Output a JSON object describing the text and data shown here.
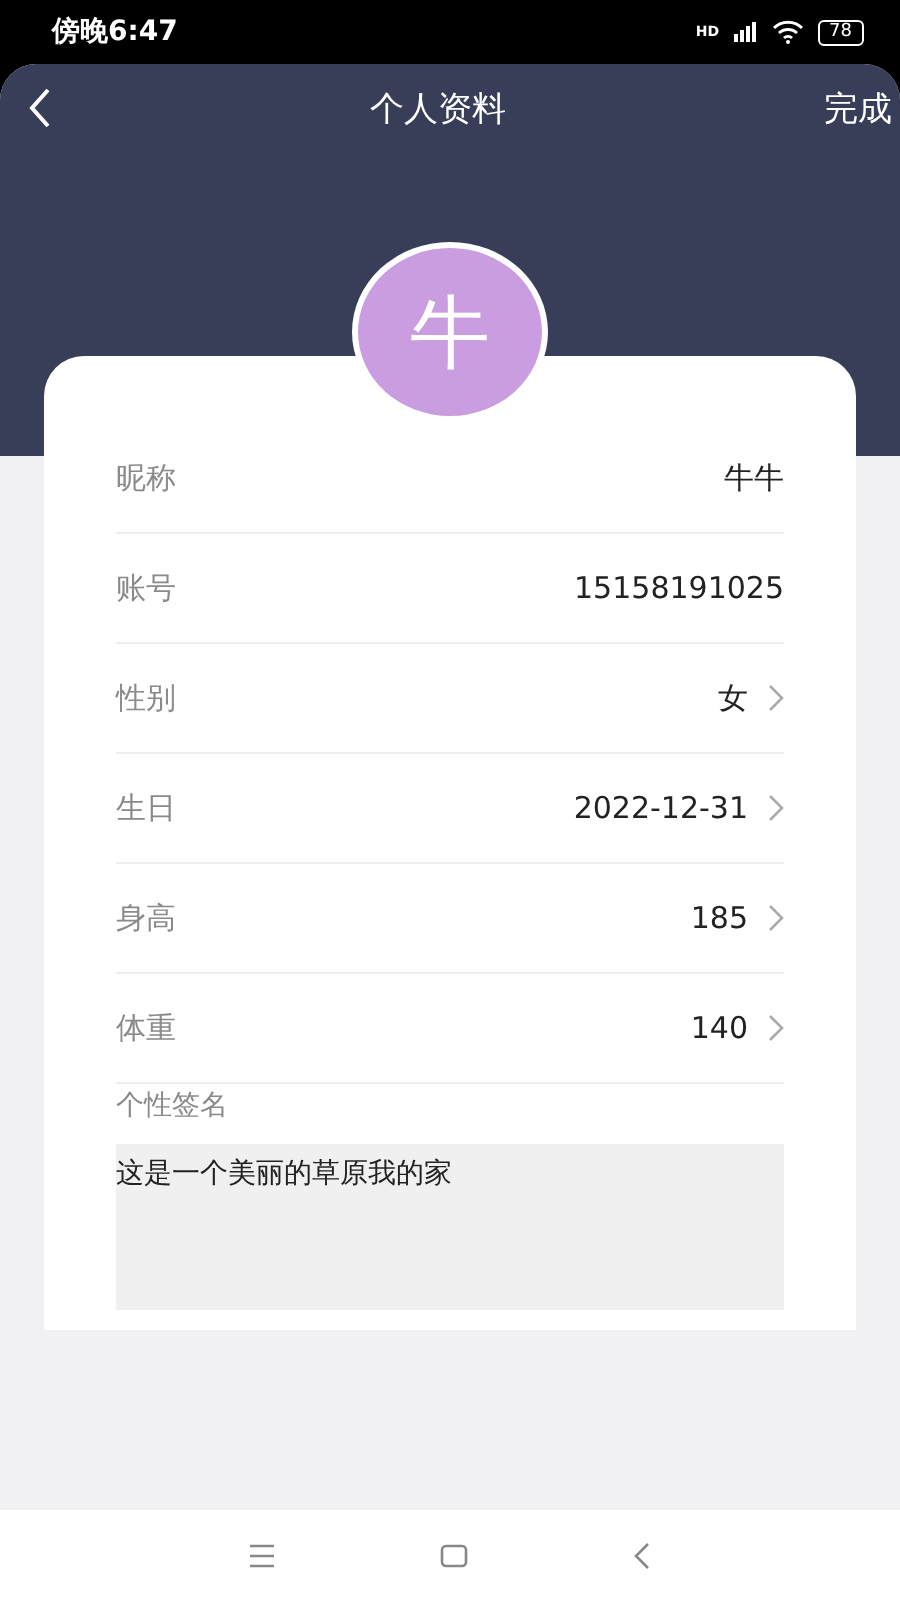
{
  "status_bar": {
    "time": "傍晚6:47",
    "network": "HD",
    "battery": "78"
  },
  "header": {
    "title": "个人资料",
    "action": "完成"
  },
  "avatar": {
    "initial": "牛"
  },
  "fields": [
    {
      "label": "昵称",
      "value": "牛牛",
      "kind": "static"
    },
    {
      "label": "账号",
      "value": "15158191025",
      "kind": "static"
    },
    {
      "label": "性别",
      "value": "女",
      "kind": "picker"
    },
    {
      "label": "生日",
      "value": "2022-12-31",
      "kind": "picker"
    },
    {
      "label": "身高",
      "value": "185",
      "kind": "picker"
    },
    {
      "label": "体重",
      "value": "140",
      "kind": "picker"
    }
  ],
  "signature": {
    "label": "个性签名",
    "value": "这是一个美丽的草原我的家"
  }
}
